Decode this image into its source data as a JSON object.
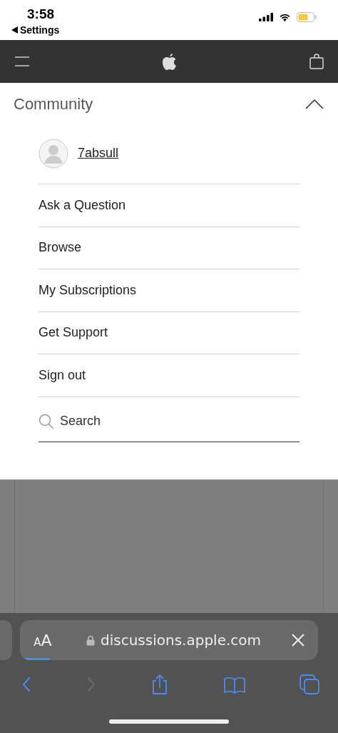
{
  "status_bar": {
    "time": "3:58",
    "back_label": "Settings"
  },
  "menu": {
    "title": "Community",
    "expanded": true,
    "user": "7absull",
    "items": [
      {
        "label": "Ask a Question"
      },
      {
        "label": "Browse"
      },
      {
        "label": "My Subscriptions"
      },
      {
        "label": "Get Support"
      },
      {
        "label": "Sign out"
      }
    ],
    "search": {
      "placeholder": "Search"
    }
  },
  "browser": {
    "text_size": "AA",
    "url": "discussions.apple.com",
    "level": 0.1,
    "toolbar": [
      {
        "kind": "back",
        "disabled": false
      },
      {
        "kind": "forward",
        "disabled": true
      },
      {
        "kind": "share",
        "disabled": false
      },
      {
        "kind": "bookmarks",
        "disabled": false
      },
      {
        "kind": "tabs",
        "disabled": false
      }
    ]
  }
}
